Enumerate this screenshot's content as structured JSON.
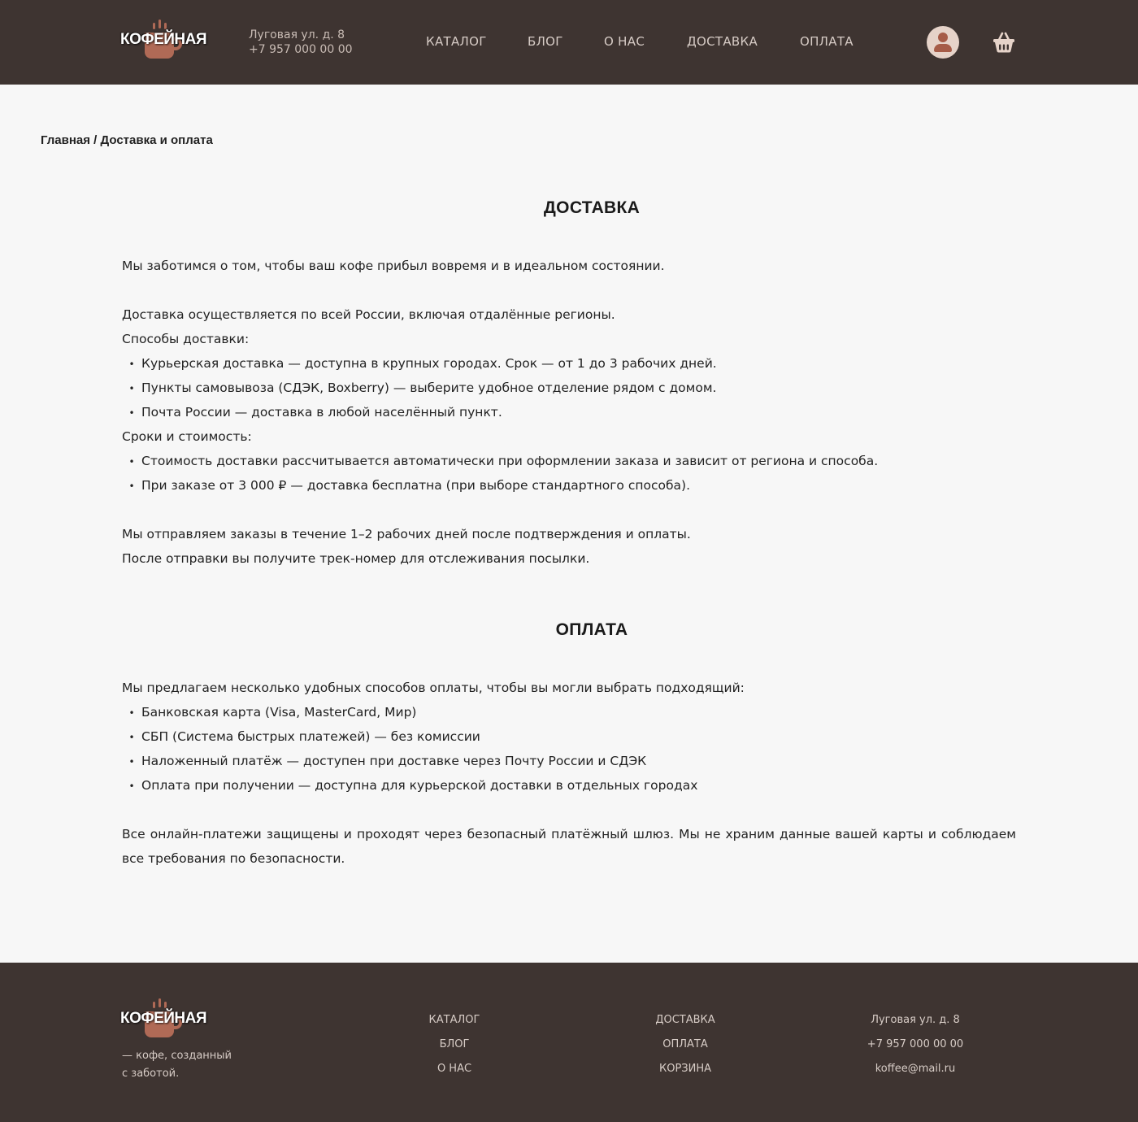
{
  "brand": {
    "name": "КОФЕЙНАЯ"
  },
  "header": {
    "address": "Луговая ул. д. 8",
    "phone": "+7 957 000 00 00",
    "nav": [
      "КАТАЛОГ",
      "БЛОГ",
      "О НАС",
      "ДОСТАВКА",
      "ОПЛАТА"
    ],
    "icons": {
      "user": "user-icon",
      "cart": "basket-icon"
    }
  },
  "breadcrumb": "Главная / Доставка и оплата",
  "delivery": {
    "title": "ДОСТАВКА",
    "intro": "Мы заботимся о том, чтобы ваш кофе прибыл вовремя и в идеальном состоянии.",
    "coverage": "Доставка осуществляется по всей России, включая отдалённые регионы.",
    "methods_label": "Способы доставки:",
    "methods": [
      "Курьерская доставка — доступна в крупных городах. Срок — от 1 до 3 рабочих дней.",
      "Пункты самовывоза (СДЭК, Boxberry) — выберите удобное отделение рядом с домом.",
      "Почта России — доставка в любой населённый пункт."
    ],
    "terms_label": "Сроки и стоимость:",
    "terms": [
      "Стоимость доставки рассчитывается автоматически при оформлении заказа и зависит от региона и способа.",
      "При заказе от 3 000 ₽ — доставка бесплатна (при выборе стандартного способа)."
    ],
    "dispatch": "Мы отправляем заказы в течение 1–2 рабочих дней после подтверждения и оплаты.",
    "tracking": "После отправки вы получите трек-номер для отслеживания посылки."
  },
  "payment": {
    "title": "ОПЛАТА",
    "intro": "Мы предлагаем несколько удобных способов оплаты, чтобы вы могли выбрать подходящий:",
    "methods": [
      "Банковская карта (Visa, MasterCard, Мир)",
      "СБП (Система быстрых платежей) — без комиссии",
      "Наложенный платёж — доступен при доставке через Почту России и СДЭК",
      "Оплата при получении — доступна для курьерской доставки в отдельных городах"
    ],
    "security": "Все онлайн-платежи защищены и проходят через безопасный платёжный шлюз. Мы не храним данные вашей карты и соблюдаем все требования по безопасности."
  },
  "footer": {
    "tagline": [
      "— кофе, созданный",
      "с заботой."
    ],
    "col1": [
      "КАТАЛОГ",
      "БЛОГ",
      "О НАС"
    ],
    "col2": [
      "ДОСТАВКА",
      "ОПЛАТА",
      "КОРЗИНА"
    ],
    "col3": [
      "Луговая ул. д. 8",
      "+7 957 000 00 00",
      "koffee@mail.ru"
    ]
  },
  "colors": {
    "dark": "#3e3431",
    "accent": "#b06a56",
    "background": "#f7f7f7"
  }
}
